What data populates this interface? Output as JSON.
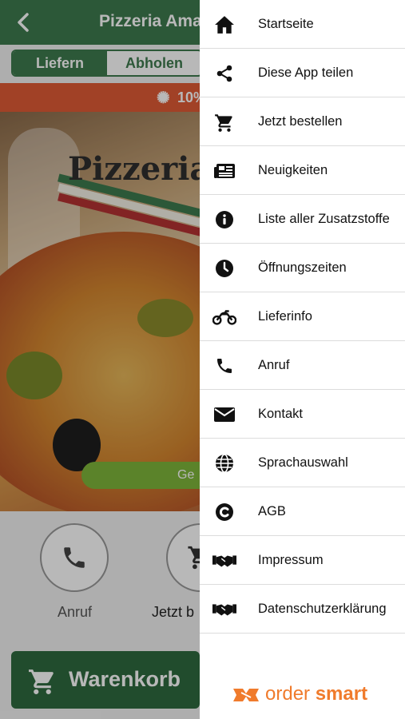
{
  "app": {
    "title": "Pizzeria Amalf",
    "tabs": {
      "deliver": "Liefern",
      "pickup": "Abholen"
    },
    "promo_text": "10%",
    "hero_logo": "Pizzeria A",
    "hero_pill": "Ge",
    "quick_actions": [
      {
        "label": "Anruf",
        "icon": "phone-icon"
      },
      {
        "label": "Jetzt b",
        "icon": "cart-icon"
      }
    ],
    "cart_label": "Warenkorb",
    "colors": {
      "primary": "#3e7a4e",
      "promo": "#e05a35",
      "pill": "#7fb63b"
    }
  },
  "drawer": {
    "items": [
      {
        "label": "Startseite",
        "icon": "home-icon"
      },
      {
        "label": "Diese App teilen",
        "icon": "share-icon"
      },
      {
        "label": "Jetzt bestellen",
        "icon": "cart-icon"
      },
      {
        "label": "Neuigkeiten",
        "icon": "news-icon"
      },
      {
        "label": "Liste aller Zusatzstoffe",
        "icon": "info-icon"
      },
      {
        "label": "Öffnungszeiten",
        "icon": "clock-icon"
      },
      {
        "label": "Lieferinfo",
        "icon": "motorcycle-icon"
      },
      {
        "label": "Anruf",
        "icon": "phone-icon"
      },
      {
        "label": "Kontakt",
        "icon": "envelope-icon"
      },
      {
        "label": "Sprachauswahl",
        "icon": "globe-icon"
      },
      {
        "label": "AGB",
        "icon": "copyright-icon"
      },
      {
        "label": "Impressum",
        "icon": "handshake-icon"
      },
      {
        "label": "Datenschutzerklärung",
        "icon": "handshake-icon"
      }
    ],
    "brand": {
      "part1": "order",
      "part2": "smart",
      "color": "#f07b2c"
    }
  }
}
